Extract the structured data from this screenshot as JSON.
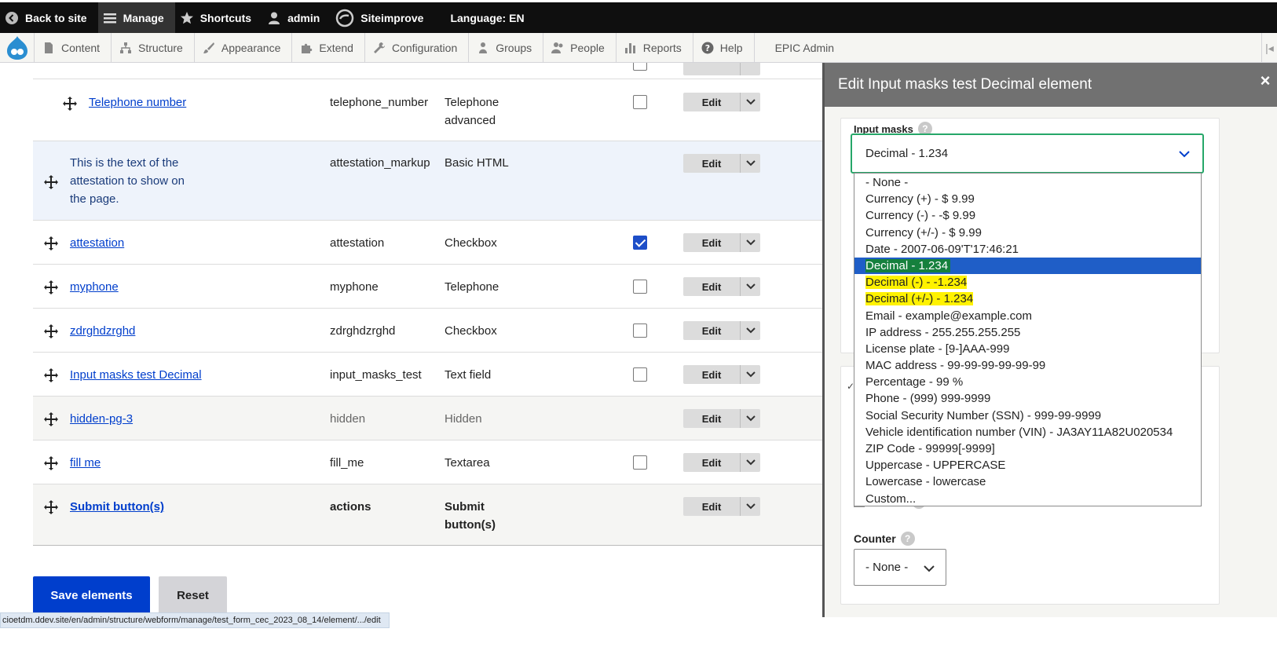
{
  "toolbar": {
    "back_to_site": "Back to site",
    "manage": "Manage",
    "shortcuts": "Shortcuts",
    "user": "admin",
    "siteimprove": "Siteimprove",
    "language": "Language: EN"
  },
  "tray": {
    "content": "Content",
    "structure": "Structure",
    "appearance": "Appearance",
    "extend": "Extend",
    "configuration": "Configuration",
    "groups": "Groups",
    "people": "People",
    "reports": "Reports",
    "help": "Help",
    "epic_admin": "EPIC Admin"
  },
  "rows": [
    {
      "title": "Telephone number",
      "key": "telephone_number",
      "type": "Telephone advanced",
      "checked": false
    },
    {
      "title": "This is the text of the attestation to show on the page.",
      "key": "attestation_markup",
      "type": "Basic HTML"
    },
    {
      "title": "attestation",
      "key": "attestation",
      "type": "Checkbox",
      "checked": true
    },
    {
      "title": "myphone",
      "key": "myphone",
      "type": "Telephone",
      "checked": false
    },
    {
      "title": "zdrghdzrghd",
      "key": "zdrghdzrghd",
      "type": "Checkbox",
      "checked": false
    },
    {
      "title": "Input masks test Decimal",
      "key": "input_masks_test",
      "type": "Text field",
      "checked": false
    },
    {
      "title": "hidden-pg-3",
      "key": "hidden",
      "type": "Hidden"
    },
    {
      "title": "fill me",
      "key": "fill_me",
      "type": "Textarea",
      "checked": false
    },
    {
      "title": "Submit button(s)",
      "key": "actions",
      "type": "Submit button(s)"
    }
  ],
  "edit_label": "Edit",
  "buttons": {
    "save": "Save elements",
    "reset": "Reset"
  },
  "status_url": "cioetdm.ddev.site/en/admin/structure/webform/manage/test_form_cec_2023_08_14/element/.../edit",
  "dialog": {
    "title": "Edit Input masks test Decimal element",
    "close": "×",
    "input_masks_label": "Input masks",
    "help": "?",
    "selected": "Decimal - 1.234",
    "options": [
      "- None -",
      "Currency (+) - $ 9.99",
      "Currency (-) - -$ 9.99",
      "Currency (+/-) - $ 9.99",
      "Date - 2007-06-09'T'17:46:21",
      "Decimal - 1.234",
      "Decimal (-) - -1.234",
      "Decimal (+/-) - 1.234",
      "Email - example@example.com",
      "IP address - 255.255.255.255",
      "License plate - [9-]AAA-999",
      "MAC address - 99-99-99-99-99-99",
      "Percentage - 99 %",
      "Phone - (999) 999-9999",
      "Social Security Number (SSN) - 999-99-9999",
      "Vehicle identification number (VIN) - JA3AY11A82U020534",
      "ZIP Code - 99999[-9999]",
      "Uppercase - UPPERCASE",
      "Lowercase - lowercase",
      "Custom..."
    ],
    "counter_label": "Counter",
    "counter_value": "- None -"
  },
  "colors": {
    "toolbar_bg": "#0f0f0f",
    "link": "#003ecc",
    "dialog_header": "#717171",
    "selected_option": "#1f5ec7",
    "focus_border": "#26a769",
    "annotation_green": "#15803d",
    "annotation_yellow": "#fff200"
  }
}
